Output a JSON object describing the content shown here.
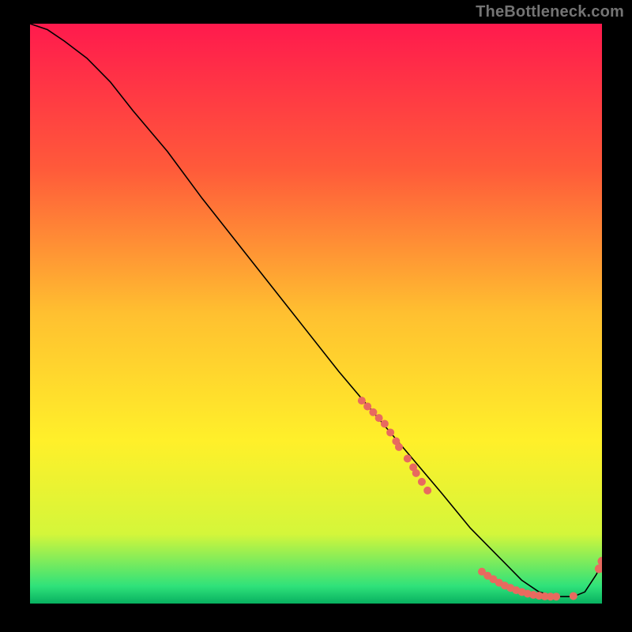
{
  "attribution": "TheBottleneck.com",
  "chart_data": {
    "type": "line",
    "title": "",
    "xlabel": "",
    "ylabel": "",
    "xlim": [
      0,
      100
    ],
    "ylim": [
      0,
      100
    ],
    "background_gradient": {
      "stops": [
        {
          "offset": 0.0,
          "color": "#ff1a4d"
        },
        {
          "offset": 0.25,
          "color": "#ff5a3a"
        },
        {
          "offset": 0.5,
          "color": "#ffc030"
        },
        {
          "offset": 0.72,
          "color": "#fff02a"
        },
        {
          "offset": 0.88,
          "color": "#d4f63a"
        },
        {
          "offset": 0.97,
          "color": "#2fe27a"
        },
        {
          "offset": 1.0,
          "color": "#08b060"
        }
      ]
    },
    "series": [
      {
        "name": "curve",
        "stroke": "#000000",
        "stroke_width": 1.6,
        "x": [
          0,
          3,
          6,
          10,
          14,
          18,
          24,
          30,
          38,
          46,
          54,
          60,
          66,
          72,
          77,
          82,
          86,
          89,
          92,
          95,
          97,
          99,
          100
        ],
        "y": [
          100,
          99,
          97,
          94,
          90,
          85,
          78,
          70,
          60,
          50,
          40,
          33,
          26,
          19,
          13,
          8,
          4,
          2,
          1.2,
          1.2,
          2,
          5,
          7
        ]
      }
    ],
    "scatter": [
      {
        "name": "cluster-upper",
        "fill": "#e86a5f",
        "r": 5,
        "points": [
          {
            "x": 58,
            "y": 35
          },
          {
            "x": 59,
            "y": 34
          },
          {
            "x": 60,
            "y": 33
          },
          {
            "x": 61,
            "y": 32
          },
          {
            "x": 62,
            "y": 31
          },
          {
            "x": 63,
            "y": 29.5
          },
          {
            "x": 64,
            "y": 28
          },
          {
            "x": 64.5,
            "y": 27
          }
        ]
      },
      {
        "name": "cluster-mid",
        "fill": "#e86a5f",
        "r": 5,
        "points": [
          {
            "x": 66,
            "y": 25
          },
          {
            "x": 67,
            "y": 23.5
          },
          {
            "x": 67.5,
            "y": 22.5
          },
          {
            "x": 68.5,
            "y": 21
          },
          {
            "x": 69.5,
            "y": 19.5
          }
        ]
      },
      {
        "name": "cluster-bottom",
        "fill": "#e86a5f",
        "r": 5,
        "points": [
          {
            "x": 79,
            "y": 5.5
          },
          {
            "x": 80,
            "y": 4.8
          },
          {
            "x": 81,
            "y": 4.2
          },
          {
            "x": 82,
            "y": 3.6
          },
          {
            "x": 83,
            "y": 3.1
          },
          {
            "x": 84,
            "y": 2.7
          },
          {
            "x": 85,
            "y": 2.3
          },
          {
            "x": 86,
            "y": 2.0
          },
          {
            "x": 87,
            "y": 1.7
          },
          {
            "x": 88,
            "y": 1.5
          },
          {
            "x": 89,
            "y": 1.35
          },
          {
            "x": 90,
            "y": 1.25
          },
          {
            "x": 91,
            "y": 1.2
          },
          {
            "x": 92,
            "y": 1.2
          },
          {
            "x": 95,
            "y": 1.3
          }
        ]
      },
      {
        "name": "top-right-pair",
        "fill": "#e86a5f",
        "r": 5.5,
        "points": [
          {
            "x": 99.5,
            "y": 6
          },
          {
            "x": 100,
            "y": 7.3
          }
        ]
      }
    ]
  }
}
